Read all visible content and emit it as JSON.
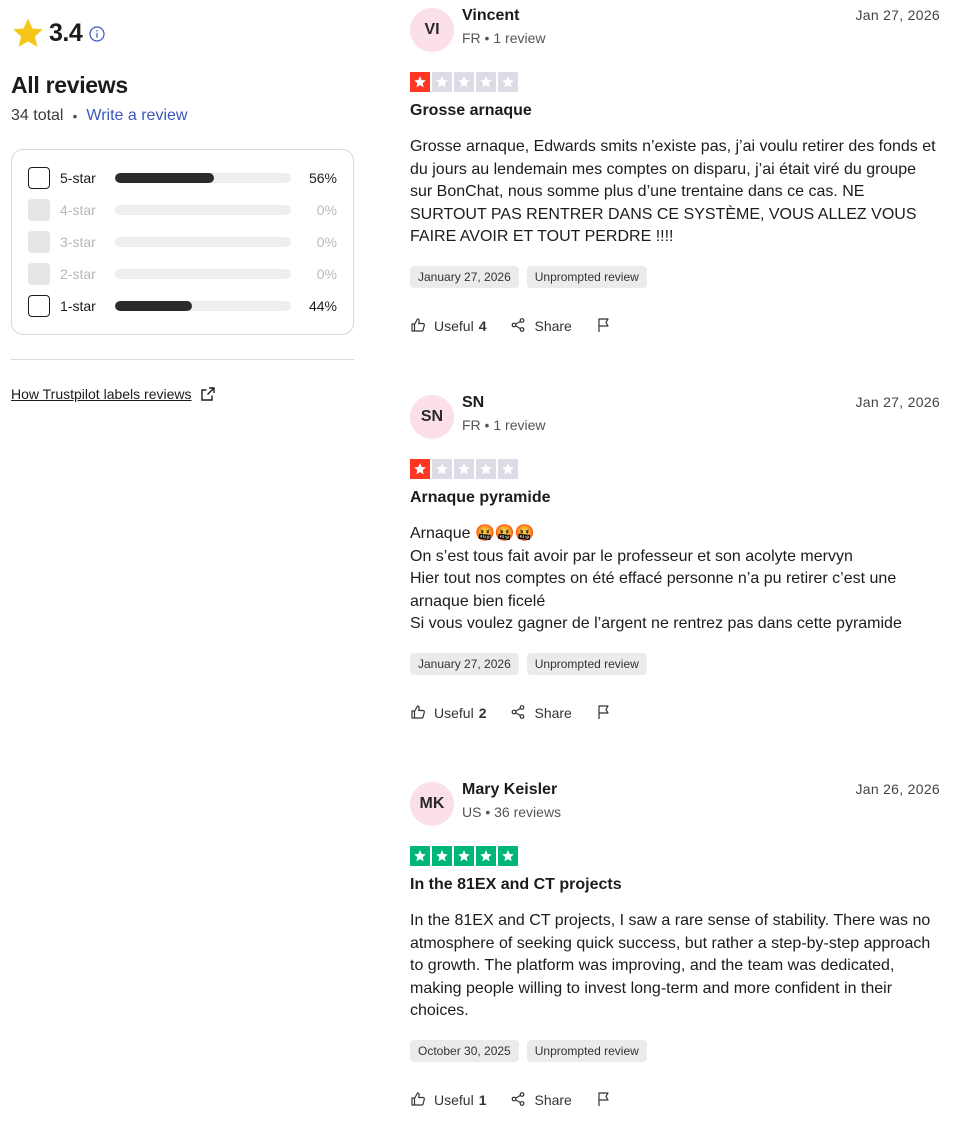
{
  "summary": {
    "rating": "3.4",
    "title": "All reviews",
    "total": "34 total",
    "write_review": "Write a review",
    "how_labels": "How Trustpilot labels reviews",
    "distribution": [
      {
        "label": "5-star",
        "pct": "56%",
        "fill": 56,
        "enabled": true
      },
      {
        "label": "4-star",
        "pct": "0%",
        "fill": 0,
        "enabled": false
      },
      {
        "label": "3-star",
        "pct": "0%",
        "fill": 0,
        "enabled": false
      },
      {
        "label": "2-star",
        "pct": "0%",
        "fill": 0,
        "enabled": false
      },
      {
        "label": "1-star",
        "pct": "44%",
        "fill": 44,
        "enabled": true
      }
    ]
  },
  "colors": {
    "star_red": "#ff3722",
    "star_green": "#00b67a",
    "star_empty": "#dcdce6",
    "star_gold": "#f5c518",
    "link": "#3c57bc"
  },
  "reviews": [
    {
      "initials": "VI",
      "name": "Vincent",
      "country": "FR",
      "count": "1 review",
      "date": "Jan 27, 2026",
      "stars": 1,
      "title": "Grosse arnaque",
      "body": [
        "Grosse arnaque, Edwards smits n’existe pas, j’ai voulu retirer des fonds et du jours au lendemain mes comptes on disparu, j’ai était viré du groupe sur BonChat, nous somme plus d’une trentaine dans ce cas. NE SURTOUT PAS RENTRER DANS CE SYSTÈME, VOUS ALLEZ VOUS FAIRE AVOIR ET TOUT PERDRE !!!!"
      ],
      "experience_date": "January 27, 2026",
      "tag": "Unprompted review",
      "useful_label": "Useful",
      "useful_count": "4",
      "share_label": "Share"
    },
    {
      "initials": "SN",
      "name": "SN",
      "country": "FR",
      "count": "1 review",
      "date": "Jan 27, 2026",
      "stars": 1,
      "title": "Arnaque pyramide",
      "body": [
        "Arnaque 🤬🤬🤬",
        "On s’est tous fait avoir par le professeur et son acolyte mervyn",
        "Hier tout nos comptes on été effacé personne n’a pu retirer c’est une arnaque bien ficelé",
        "Si vous voulez gagner de l’argent ne rentrez pas dans cette pyramide"
      ],
      "experience_date": "January 27, 2026",
      "tag": "Unprompted review",
      "useful_label": "Useful",
      "useful_count": "2",
      "share_label": "Share"
    },
    {
      "initials": "MK",
      "name": "Mary Keisler",
      "country": "US",
      "count": "36 reviews",
      "date": "Jan 26, 2026",
      "stars": 5,
      "title": "In the 81EX and CT projects",
      "body": [
        "In the 81EX and CT projects, I saw a rare sense of stability. There was no atmosphere of seeking quick success, but rather a step-by-step approach to growth. The platform was improving, and the team was dedicated, making people willing to invest long-term and more confident in their choices."
      ],
      "experience_date": "October 30, 2025",
      "tag": "Unprompted review",
      "useful_label": "Useful",
      "useful_count": "1",
      "share_label": "Share"
    }
  ]
}
